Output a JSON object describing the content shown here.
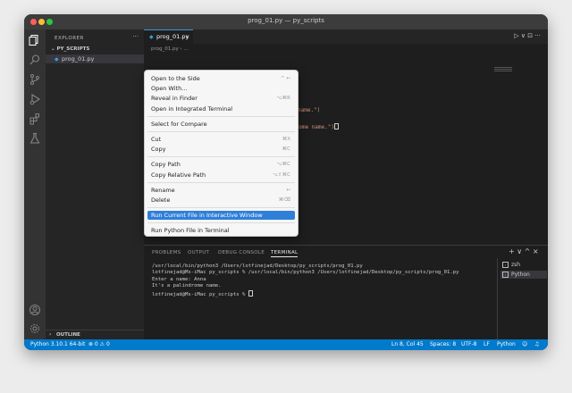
{
  "window": {
    "title": "prog_01.py — py_scripts"
  },
  "activity_bar": {
    "icons": [
      "files-icon",
      "search-icon",
      "source-control-icon",
      "run-debug-icon",
      "extensions-icon",
      "testing-icon",
      "account-icon",
      "settings-gear-icon"
    ]
  },
  "sidebar": {
    "header": "EXPLORER",
    "more": "···",
    "folder": "PY_SCRIPTS",
    "file": "prog_01.py",
    "outline": "OUTLINE"
  },
  "editor": {
    "tab": {
      "label": "prog_01.py",
      "close": "×"
    },
    "breadcrumb": "prog_01.py › ...",
    "actions": "▷ ∨   ⊡   ···",
    "visible_code": [
      "name.\")",
      "drome name.\")"
    ]
  },
  "context_menu": {
    "groups": [
      [
        {
          "label": "Open to the Side",
          "shortcut": "^ ↩"
        },
        {
          "label": "Open With...",
          "shortcut": ""
        },
        {
          "label": "Reveal in Finder",
          "shortcut": "⌥⌘R"
        },
        {
          "label": "Open in Integrated Terminal",
          "shortcut": ""
        }
      ],
      [
        {
          "label": "Select for Compare",
          "shortcut": ""
        }
      ],
      [
        {
          "label": "Cut",
          "shortcut": "⌘X"
        },
        {
          "label": "Copy",
          "shortcut": "⌘C"
        }
      ],
      [
        {
          "label": "Copy Path",
          "shortcut": "⌥⌘C"
        },
        {
          "label": "Copy Relative Path",
          "shortcut": "⌥⇧⌘C"
        }
      ],
      [
        {
          "label": "Rename",
          "shortcut": "↩"
        },
        {
          "label": "Delete",
          "shortcut": "⌘⌫"
        }
      ],
      [
        {
          "label": "Run Current File in Interactive Window",
          "shortcut": "",
          "highlighted": true
        }
      ],
      [
        {
          "label": "Run Python File in Terminal",
          "shortcut": ""
        }
      ]
    ]
  },
  "panel": {
    "tabs": [
      "PROBLEMS",
      "OUTPUT",
      "DEBUG CONSOLE",
      "TERMINAL"
    ],
    "active_tab": "TERMINAL",
    "actions": "+ ∨  ^  ×",
    "terminal_lines": [
      "/usr/local/bin/python3 /Users/lotfinejad/Desktop/py_scripts/prog_01.py",
      "lotfinejad@Ms-iMac py_scripts % /usr/local/bin/python3 /Users/lotfinejad/Desktop/py_scripts/prog_01.py",
      "Enter a name: Anna",
      "It's a palindrome name.",
      "lotfinejad@Ms-iMac py_scripts % "
    ],
    "terminals": [
      {
        "label": "zsh",
        "selected": false
      },
      {
        "label": "Python",
        "selected": true
      }
    ]
  },
  "status_bar": {
    "python": "Python 3.10.1 64-bit",
    "problems": "⊗ 0 ⚠ 0",
    "position": "Ln 8, Col 45",
    "spaces": "Spaces: 8",
    "encoding": "UTF-8",
    "eol": "LF",
    "language": "Python"
  },
  "colors": {
    "accent": "#007acc",
    "menu_highlight": "#2f7fd9"
  }
}
